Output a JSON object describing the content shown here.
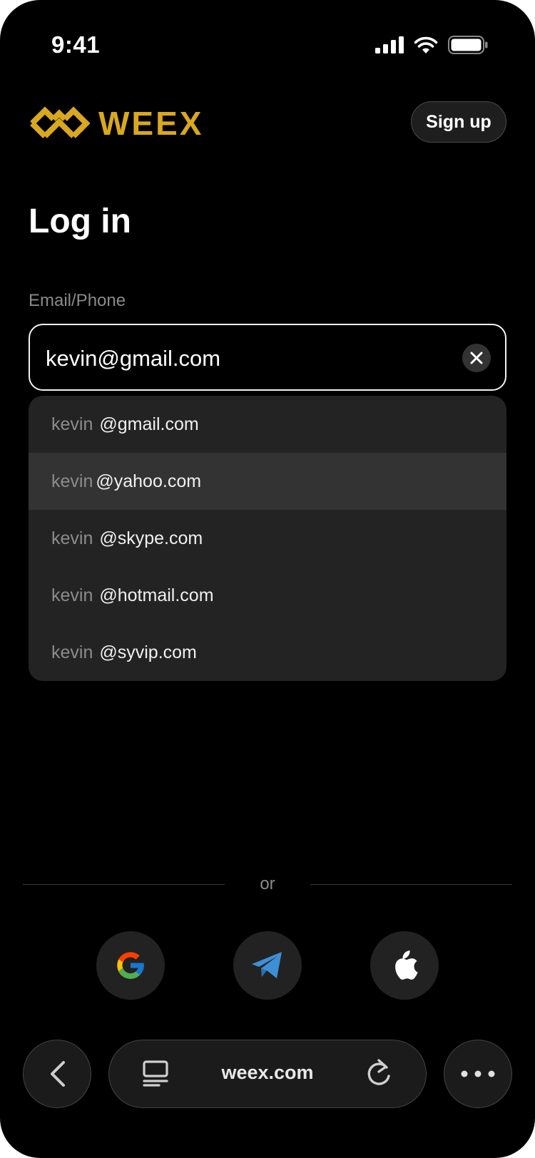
{
  "status_bar": {
    "time": "9:41"
  },
  "header": {
    "brand": "WEEX",
    "signup_label": "Sign up"
  },
  "page": {
    "title": "Log in"
  },
  "form": {
    "email_label": "Email/Phone",
    "email_value": "kevin@gmail.com"
  },
  "suggestions": [
    {
      "prefix": "kevin",
      "domain": "@gmail.com"
    },
    {
      "prefix": "kevin",
      "domain": "@yahoo.com",
      "highlighted": true
    },
    {
      "prefix": "kevin",
      "domain": "@skype.com"
    },
    {
      "prefix": "kevin",
      "domain": "@hotmail.com"
    },
    {
      "prefix": "kevin",
      "domain": "@syvip.com"
    }
  ],
  "divider": {
    "text": "or"
  },
  "social_logins": [
    "google-icon",
    "telegram-icon",
    "apple-icon"
  ],
  "browser": {
    "url": "weex.com"
  },
  "colors": {
    "brand_gold": "#d9a81e",
    "background": "#000000",
    "telegram_blue": "#3d8fd6"
  }
}
